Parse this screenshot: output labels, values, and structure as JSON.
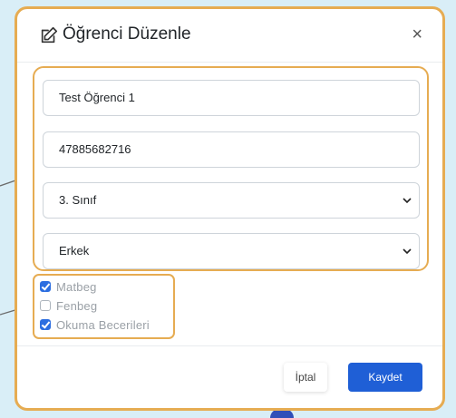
{
  "modal": {
    "title": "Öğrenci Düzenle",
    "close_icon": "×"
  },
  "fields": {
    "name_value": "Test Öğrenci 1",
    "id_value": "47885682716",
    "class_selected": "3. Sınıf",
    "gender_selected": "Erkek"
  },
  "courses": [
    {
      "label": "Matbeg",
      "checked": true
    },
    {
      "label": "Fenbeg",
      "checked": false
    },
    {
      "label": "Okuma Becerileri",
      "checked": true
    }
  ],
  "footer": {
    "cancel_label": "İptal",
    "save_label": "Kaydet"
  },
  "colors": {
    "highlight": "#e6ac52",
    "primary": "#1f5fd6",
    "checkbox": "#2c6ee0",
    "background": "#d9eef7"
  },
  "icons": {
    "edit": "edit-icon",
    "close": "close-icon",
    "chevron": "chevron-down-icon",
    "check": "check-icon"
  }
}
